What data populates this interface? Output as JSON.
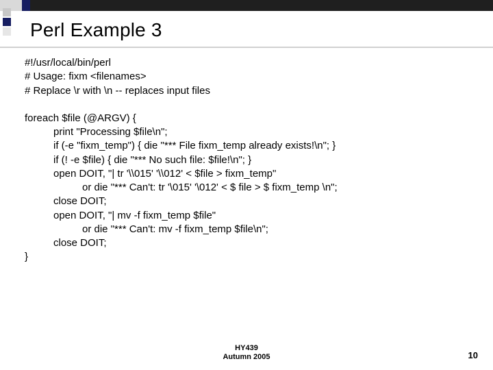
{
  "slide": {
    "title": "Perl Example 3",
    "intro": [
      "#!/usr/local/bin/perl",
      "# Usage: fixm <filenames>",
      "# Replace \\r with \\n -- replaces input files"
    ],
    "code": {
      "l0": "foreach $file (@ARGV) {",
      "l1": "print \"Processing $file\\n\";",
      "l2": "if (-e \"fixm_temp\") { die \"*** File fixm_temp already exists!\\n\"; }",
      "l3": "if (! -e $file) { die \"*** No such file: $file!\\n\"; }",
      "l4": "open DOIT, \"| tr '\\\\015' '\\\\012' < $file > fixm_temp\"",
      "l5": "or die \"*** Can't: tr '\\015' '\\012' < $ file > $ fixm_temp \\n\";",
      "l6": "close DOIT;",
      "l7": "open DOIT, \"| mv -f fixm_temp $file\"",
      "l8": "or die \"*** Can't: mv -f fixm_temp $file\\n\";",
      "l9": "close DOIT;",
      "l10": "}"
    }
  },
  "footer": {
    "course": "HY439",
    "term": "Autumn 2005",
    "page": "10"
  }
}
